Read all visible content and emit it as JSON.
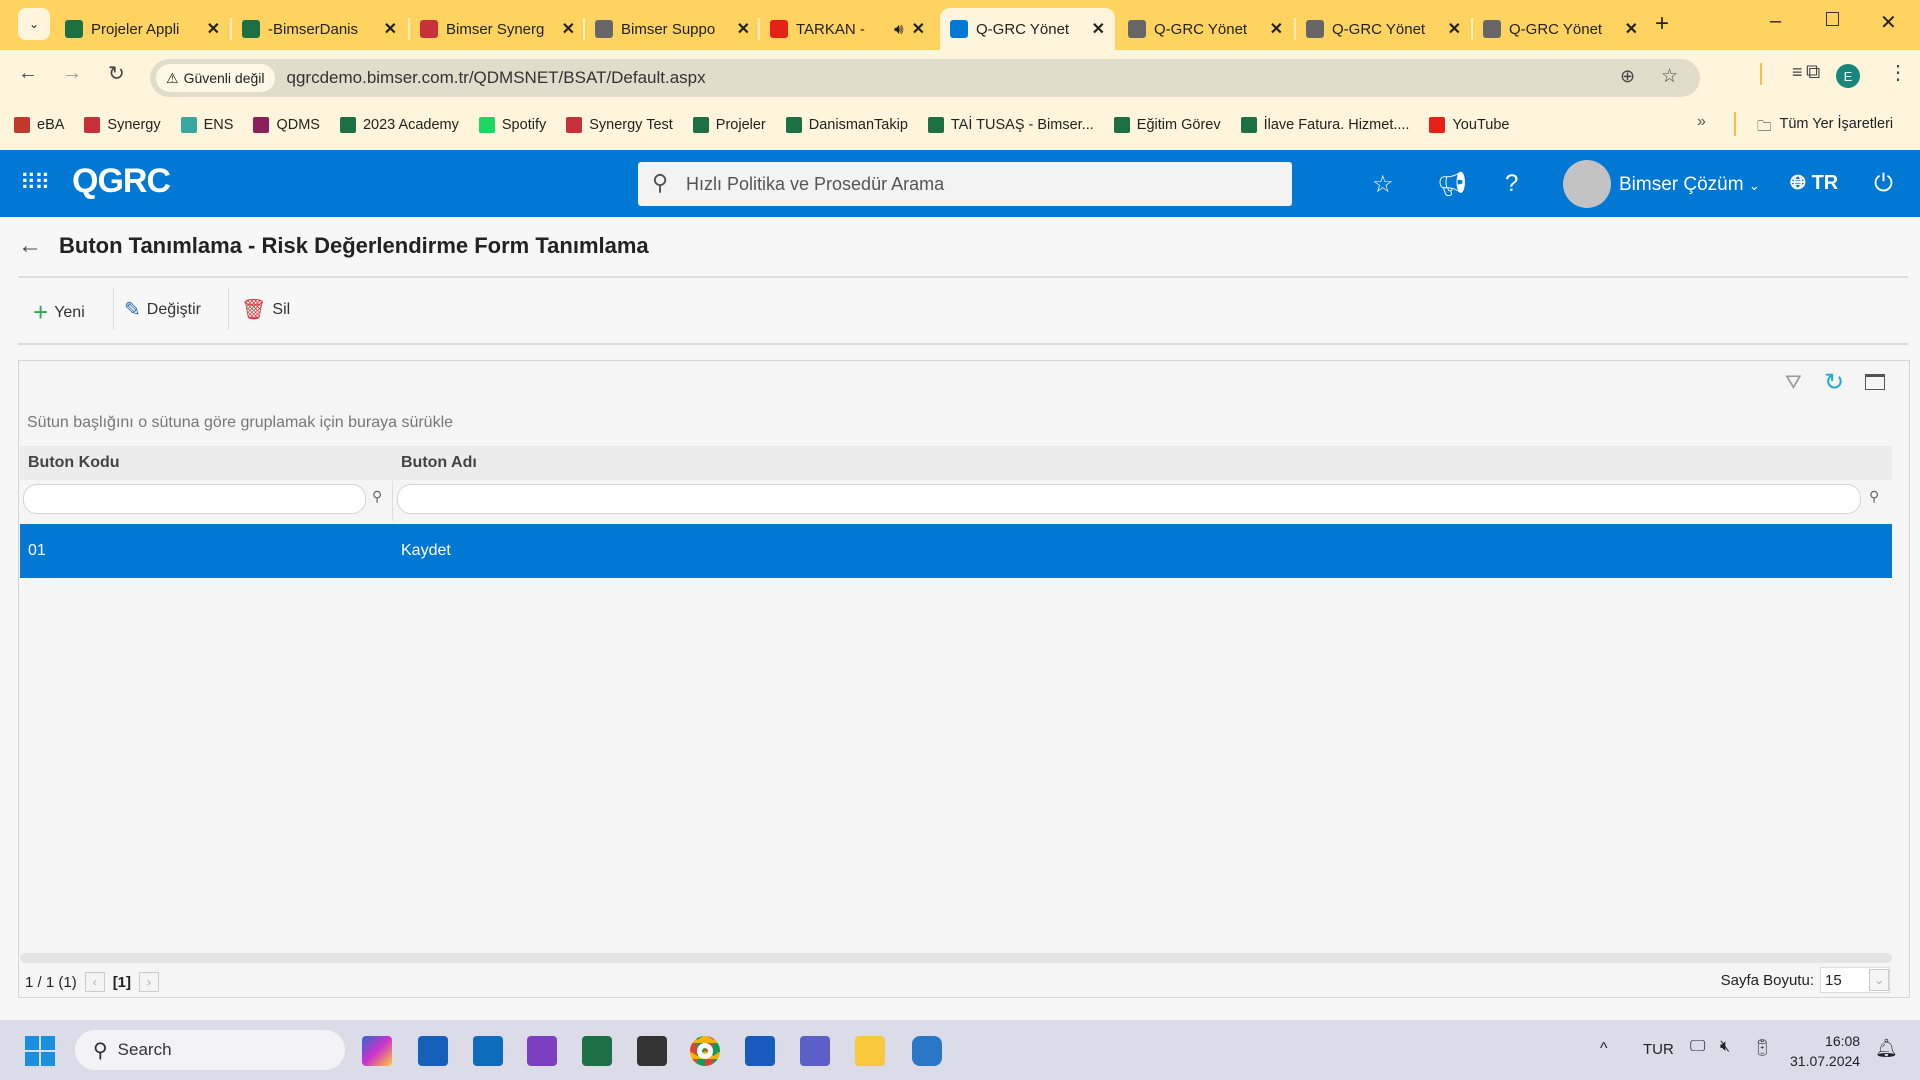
{
  "browser": {
    "tabs": [
      {
        "title": "Projeler Appli",
        "icon": "excel-icon",
        "color": "#1d7044"
      },
      {
        "title": "-BimserDanis",
        "icon": "excel-icon",
        "color": "#1d7044"
      },
      {
        "title": "Bimser Synerg",
        "icon": "synergy-icon",
        "color": "#c8303a"
      },
      {
        "title": "Bimser Suppo",
        "icon": "globe-icon",
        "color": "#666666"
      },
      {
        "title": "TARKAN -",
        "icon": "youtube-icon",
        "color": "#e62117"
      },
      {
        "title": "Q-GRC Yönet",
        "icon": "qgrc-icon",
        "color": "#0078d4"
      },
      {
        "title": "Q-GRC Yönet",
        "icon": "globe-icon",
        "color": "#666666"
      },
      {
        "title": "Q-GRC Yönet",
        "icon": "globe-icon",
        "color": "#666666"
      },
      {
        "title": "Q-GRC Yönet",
        "icon": "globe-icon",
        "color": "#666666"
      }
    ],
    "security": "Güvenli değil",
    "url": "qgrcdemo.bimser.com.tr/QDMSNET/BSAT/Default.aspx",
    "profile": "E",
    "bookmarks": [
      {
        "label": "eBA",
        "color": "#c0392b"
      },
      {
        "label": "Synergy",
        "color": "#c8303a"
      },
      {
        "label": "ENS",
        "color": "#3aa6a0"
      },
      {
        "label": "QDMS",
        "color": "#8b1e5c"
      },
      {
        "label": "2023 Academy",
        "color": "#1d7044"
      },
      {
        "label": "Spotify",
        "color": "#1ed760"
      },
      {
        "label": "Synergy Test",
        "color": "#c8303a"
      },
      {
        "label": "Projeler",
        "color": "#1d7044"
      },
      {
        "label": "DanismanTakip",
        "color": "#1d7044"
      },
      {
        "label": "TAİ TUSAŞ - Bimser...",
        "color": "#1d7044"
      },
      {
        "label": "Eğitim Görev",
        "color": "#1d7044"
      },
      {
        "label": "İlave Fatura. Hizmet....",
        "color": "#1d7044"
      },
      {
        "label": "YouTube",
        "color": "#e62117"
      }
    ],
    "all_bookmarks": "Tüm Yer İşaretleri"
  },
  "app": {
    "logo": "QGRC",
    "search_placeholder": "Hızlı Politika ve Prosedür Arama",
    "user": "Bimser Çözüm",
    "lang": "TR",
    "accent": "#0078d4"
  },
  "page": {
    "title": "Buton Tanımlama - Risk Değerlendirme Form Tanımlama",
    "toolbar": {
      "new": "Yeni",
      "edit": "Değiştir",
      "delete": "Sil"
    },
    "grid": {
      "group_hint": "Sütun başlığını o sütuna göre gruplamak için buraya sürükle",
      "columns": [
        "Buton Kodu",
        "Buton Adı"
      ],
      "rows": [
        [
          "01",
          "Kaydet"
        ]
      ],
      "pager_summary": "1 / 1 (1)",
      "current_page": "[1]",
      "page_size_label": "Sayfa Boyutu:",
      "page_size": "15"
    }
  },
  "taskbar": {
    "search": "Search",
    "lang": "TUR",
    "time": "16:08",
    "date": "31.07.2024"
  }
}
